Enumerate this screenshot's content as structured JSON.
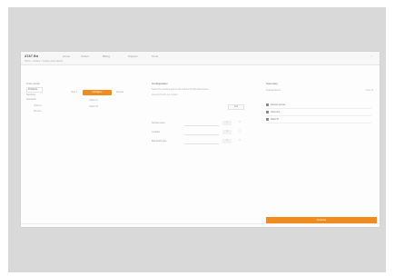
{
  "app": {
    "logo": "AT&T Biz",
    "nav": [
      "Home",
      "Orders",
      "Billing",
      "Support",
      "Tools"
    ],
    "address_bar": "Home > Orders > Create order wizard"
  },
  "sidebar": {
    "heading": "Order details",
    "selected": "Products",
    "items": [
      "Services",
      "Accounts"
    ],
    "sub": [
      "Options",
      "Review"
    ]
  },
  "wizard": {
    "steps": [
      "Step 1",
      "Configure",
      "Review"
    ],
    "active_step": "Configure",
    "substeps": [
      "Option A",
      "Option B"
    ]
  },
  "details": {
    "title": "Configuration",
    "description": "Select the services and set the options for this order below.",
    "note": "Required fields are marked",
    "button": "Edit",
    "rows": [
      {
        "label": "Service name",
        "v1": "1",
        "v2": "0"
      },
      {
        "label": "Location",
        "v1": "1",
        "v2": "0"
      },
      {
        "label": "Bandwidth plan",
        "v1": "1",
        "v2": "0"
      }
    ]
  },
  "summary": {
    "title": "Summary",
    "subtitle": "Selected items",
    "link": "Clear all",
    "items": [
      "Internet service",
      "Voice line",
      "Static IP"
    ]
  },
  "footer": {
    "submit_label": "Continue"
  },
  "colors": {
    "accent": "#f08c1e",
    "frame": "#d9d9d9"
  }
}
